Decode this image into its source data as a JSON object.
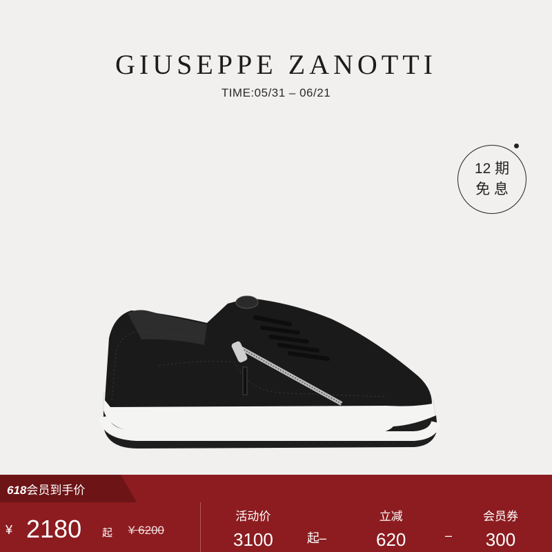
{
  "brand": "GIUSEPPE  ZANOTTI",
  "time": "TIME:05/31 – 06/21",
  "badge": {
    "line1": "12 期",
    "line2": "免 息"
  },
  "promo": {
    "tag_num": "618",
    "tag_text": "会员到手价",
    "currency": "¥",
    "price": "2180",
    "qi": "起",
    "orig": "¥ 6200",
    "activity_label": "活动价",
    "activity_value": "3100",
    "op1": "起–",
    "reduce_label": "立减",
    "reduce_value": "620",
    "op2": "–",
    "coupon_label": "会员券",
    "coupon_value": "300"
  },
  "colors": {
    "bar": "#8c1c20",
    "tag": "#6d1417",
    "background": "#f1f0ef"
  }
}
